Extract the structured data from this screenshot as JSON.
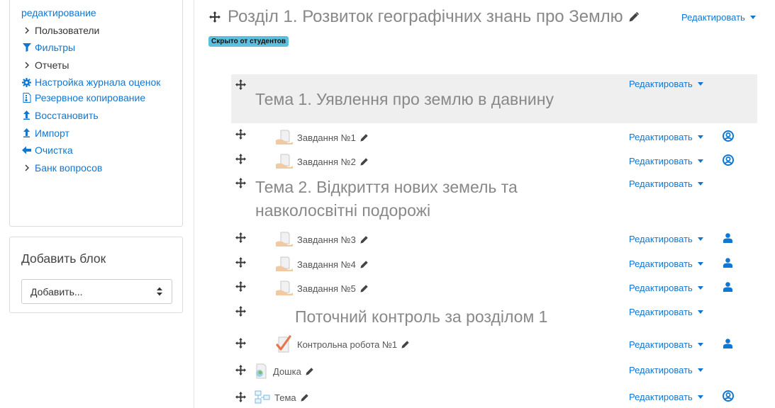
{
  "sidebar": {
    "admin_items": [
      {
        "label": "редактирование",
        "icon": "none",
        "type": "link"
      },
      {
        "label": "Пользователи",
        "icon": "chevron-right-icon",
        "type": "plain"
      },
      {
        "label": "Фильтры",
        "icon": "filter-icon",
        "type": "link"
      },
      {
        "label": "Отчеты",
        "icon": "chevron-right-icon",
        "type": "plain"
      },
      {
        "label": "Настройка журнала оценок",
        "icon": "cog-icon",
        "type": "link"
      },
      {
        "label": "Резервное копирование",
        "icon": "file-archive-icon",
        "type": "link"
      },
      {
        "label": "Восстановить",
        "icon": "upload-icon",
        "type": "link"
      },
      {
        "label": "Импорт",
        "icon": "upload-icon",
        "type": "link"
      },
      {
        "label": "Очистка",
        "icon": "arrow-left-icon",
        "type": "link"
      },
      {
        "label": "Банк вопросов",
        "icon": "chevron-right-icon",
        "type": "plain"
      }
    ],
    "add_block": {
      "title": "Добавить блок",
      "select_value": "Добавить..."
    }
  },
  "section": {
    "title": "Розділ 1. Розвиток географічних знань про Землю",
    "edit_label": "Редактировать",
    "badge": "Скрыто от студентов"
  },
  "rows": {
    "topic1": {
      "title": "Тема 1. Уявлення про землю в давнину",
      "edit": "Редактировать"
    },
    "task1": {
      "title": "Завдання №1",
      "edit": "Редактировать",
      "status_icon": "user-circle-icon"
    },
    "task2": {
      "title": "Завдання №2",
      "edit": "Редактировать",
      "status_icon": "user-circle-icon"
    },
    "topic2": {
      "title_line1": "Тема 2. Відкриття нових земель та",
      "title_line2": "навколосвітні подорожі",
      "edit": "Редактировать"
    },
    "task3": {
      "title": "Завдання №3",
      "edit": "Редактировать",
      "status_icon": "user-icon"
    },
    "task4": {
      "title": "Завдання №4",
      "edit": "Редактировать",
      "status_icon": "user-icon"
    },
    "task5": {
      "title": "Завдання №5",
      "edit": "Редактировать",
      "status_icon": "user-icon"
    },
    "control": {
      "title": "Поточний контроль за розділом 1",
      "edit": "Редактировать"
    },
    "test1": {
      "title": "Контрольна робота №1",
      "edit": "Редактировать",
      "status_icon": "user-icon"
    },
    "board": {
      "title": "Дошка",
      "edit": "Редактировать"
    },
    "theme": {
      "title": "Тема",
      "edit": "Редактировать",
      "status_icon": "user-circle-icon"
    }
  },
  "colors": {
    "link": "#1177d1",
    "badge": "#5bc0de",
    "muted": "#888888"
  }
}
